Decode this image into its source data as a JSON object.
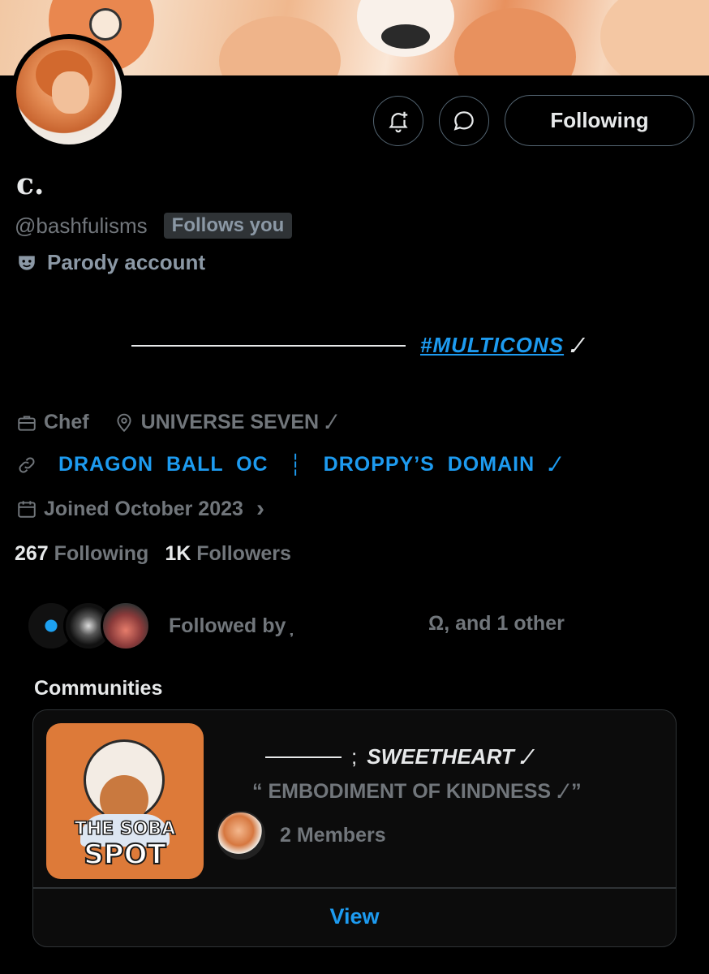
{
  "profile": {
    "display_name": "c.",
    "handle": "@bashfulisms",
    "follows_you": "Follows you",
    "parody_label": "Parody account",
    "bio": {
      "hashtag": "#MULTICONS",
      "tail": ".⁄"
    },
    "occupation": "Chef",
    "location": "UNIVERSE SEVEN .⁄",
    "link_part1": "DRAGON  BALL  OC",
    "link_sep": "┆",
    "link_part2": "DROPPY’S  DOMAIN  .⁄",
    "joined": "Joined October 2023",
    "joined_chevron": "›"
  },
  "actions": {
    "follow_label": "Following",
    "notify_icon": "bell-plus-icon",
    "message_icon": "message-bubble-icon"
  },
  "stats": {
    "following_count": "267",
    "following_label": "Following",
    "followers_count": "1K",
    "followers_label": "Followers"
  },
  "followed_by": {
    "prefix": "Followed by ̦̦",
    "suffix": "Ω, and 1 other"
  },
  "communities": {
    "heading": "Communities",
    "card": {
      "name": "SWEETHEART .⁄",
      "semicolon": ";",
      "tagline": "“ EMBODIMENT OF KINDNESS .⁄ ”",
      "members": "2 Members",
      "view_label": "View",
      "image_text_1": "THE SOBA",
      "image_text_2": "SPOT"
    }
  },
  "colors": {
    "accent": "#1d9bf0",
    "muted": "#71767b",
    "border": "#2f3336"
  }
}
